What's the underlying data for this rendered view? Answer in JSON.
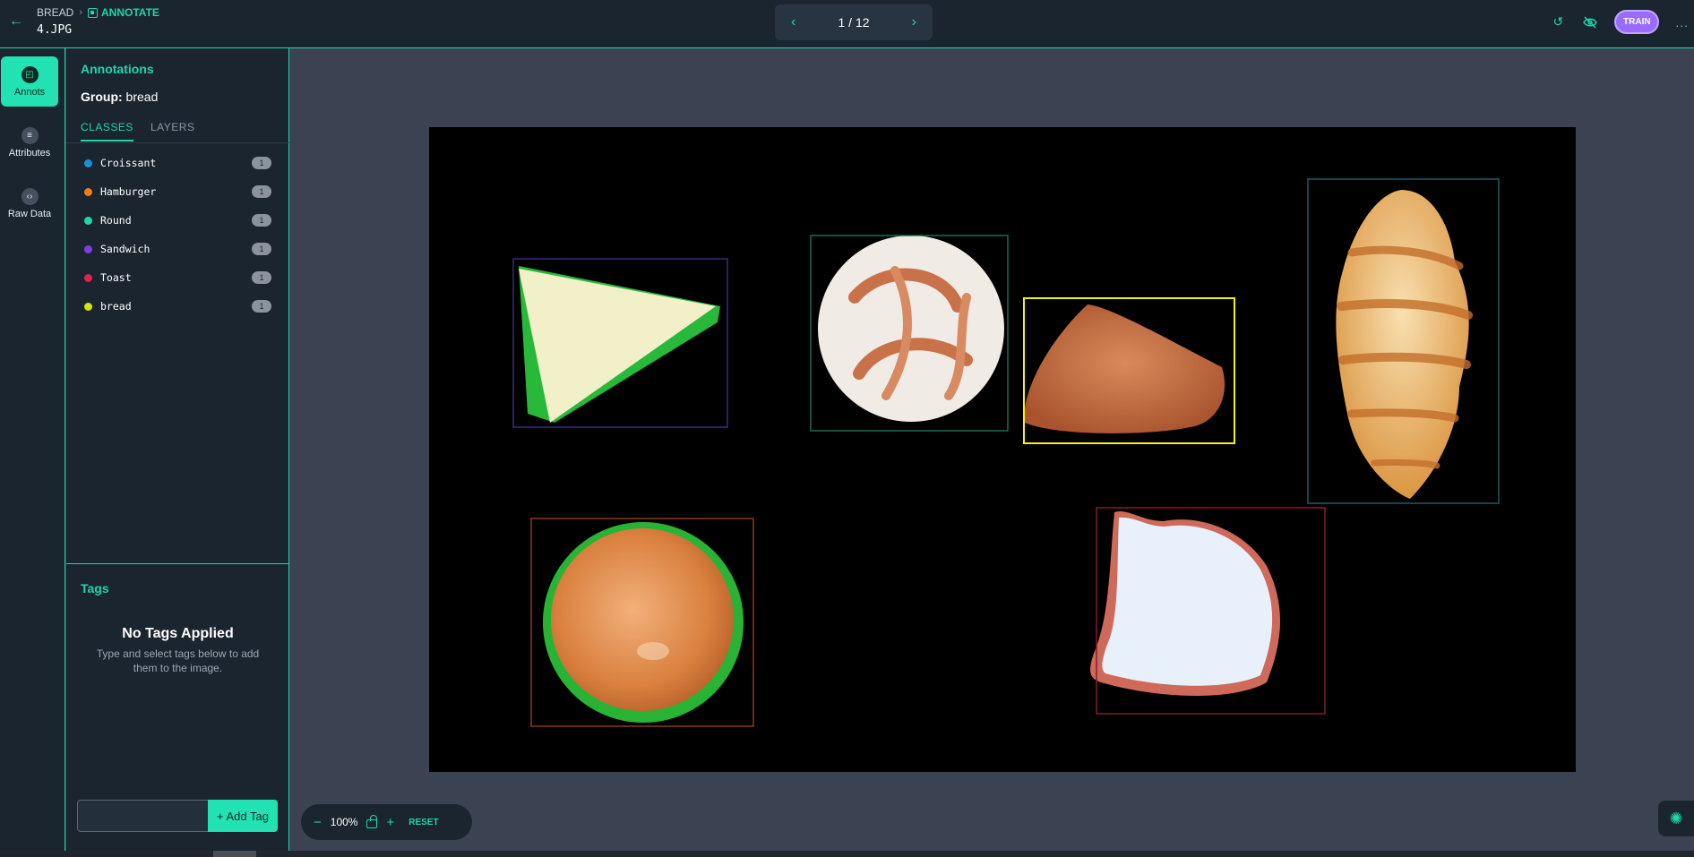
{
  "header": {
    "back_icon": "arrow-left-icon",
    "project": "BREAD",
    "separator": "›",
    "mode": "ANNOTATE",
    "filename": "4.JPG"
  },
  "pager": {
    "prev_icon": "chevron-left-icon",
    "label": "1 / 12",
    "next_icon": "chevron-right-icon"
  },
  "top_right": {
    "history_icon": "history-icon",
    "visibility_icon": "eye-off-icon",
    "train_label": "TRAIN",
    "more_label": "..."
  },
  "rail": [
    {
      "label": "Annots",
      "icon": "annotation-icon",
      "active": true
    },
    {
      "label": "Attributes",
      "icon": "list-icon",
      "active": false
    },
    {
      "label": "Raw Data",
      "icon": "code-icon",
      "active": false
    }
  ],
  "panel": {
    "title": "Annotations",
    "group_label": "Group:",
    "group_value": "bread",
    "tabs": [
      "CLASSES",
      "LAYERS"
    ],
    "classes": [
      {
        "name": "Croissant",
        "count": "1",
        "color": "#1a8fd8"
      },
      {
        "name": "Hamburger",
        "count": "1",
        "color": "#f07d1a"
      },
      {
        "name": "Round",
        "count": "1",
        "color": "#1fd6a8"
      },
      {
        "name": "Sandwich",
        "count": "1",
        "color": "#7b3fe4"
      },
      {
        "name": "Toast",
        "count": "1",
        "color": "#e0234e"
      },
      {
        "name": "bread",
        "count": "1",
        "color": "#d4e40f"
      }
    ]
  },
  "tags": {
    "title": "Tags",
    "empty_title": "No Tags Applied",
    "empty_desc": "Type and select tags below to add them to the image.",
    "input_value": "",
    "add_label": "+ Add Tag"
  },
  "annotations_colors": {
    "sandwich": "#3a2a7a",
    "round": "#1d6b56",
    "bread": "#f2f21a",
    "croissant": "#1d5c66",
    "hamburger": "#8a3a1a",
    "toast": "#8a1a2a"
  },
  "zoom": {
    "zoom_out_icon": "minus-icon",
    "value": "100%",
    "lock_icon": "lock-open-icon",
    "zoom_in_icon": "plus-icon",
    "reset_label": "RESET"
  },
  "settings_icon": "settings-icon"
}
